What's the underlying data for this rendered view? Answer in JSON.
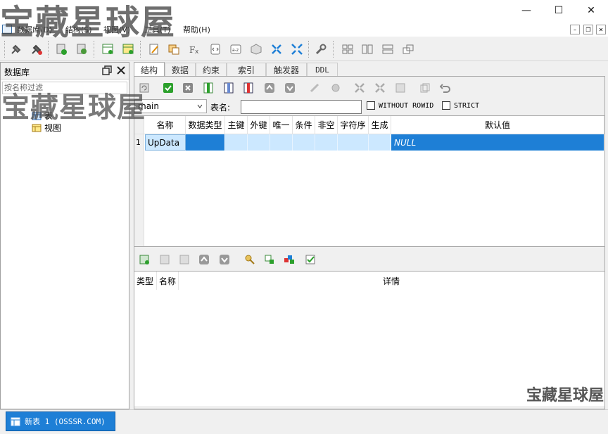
{
  "watermark": {
    "top": "宝藏星球屋",
    "middle": "宝藏星球屋",
    "corner": "宝藏星球屋"
  },
  "window": {
    "minimize": "—",
    "maximize": "☐",
    "close": "✕"
  },
  "menu": {
    "items": [
      "数据库(D)",
      "结构(S)",
      "视图(V)",
      "工具(T)",
      "帮助(H)"
    ],
    "mdi_min": "–",
    "mdi_restore": "❐",
    "mdi_close": "✕"
  },
  "left_panel": {
    "title": "数据库",
    "filter_placeholder": "按名称过滤",
    "tree": [
      {
        "label": "表"
      },
      {
        "label": "视图"
      }
    ]
  },
  "tabs": [
    "结构",
    "数据",
    "约束",
    "索引",
    "触发器",
    "DDL"
  ],
  "structure": {
    "schema_select": "main",
    "table_name_label": "表名:",
    "table_name_value": "",
    "without_rowid_label": "WITHOUT ROWID",
    "strict_label": "STRICT"
  },
  "columns_grid": {
    "headers": [
      "名称",
      "数据类型",
      "主键",
      "外键",
      "唯一",
      "条件",
      "非空",
      "字符序",
      "生成",
      "默认值"
    ],
    "rows": [
      {
        "num": "1",
        "name": "UpData",
        "default": "NULL"
      }
    ]
  },
  "constraints_grid": {
    "headers": [
      "类型",
      "名称",
      "详情"
    ]
  },
  "bottom": {
    "doc_tab": "新表 1 (OSSSR.COM)"
  },
  "colors": {
    "selection": "#1e7fd6",
    "selection_light": "#cce8ff",
    "green_ok": "#2ca02c"
  }
}
